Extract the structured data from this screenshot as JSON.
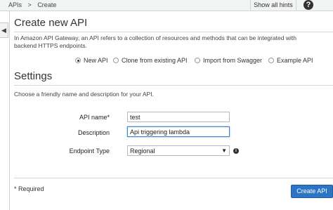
{
  "topbar": {
    "breadcrumb": [
      "APIs",
      ">",
      "Create"
    ],
    "hints_label": "Show all hints",
    "help_glyph": "?"
  },
  "sidebar_toggle_glyph": "◀",
  "create_section": {
    "title": "Create new API",
    "intro": "In Amazon API Gateway, an API refers to a collection of resources and methods that can be integrated with backend HTTPS endpoints.",
    "options": [
      {
        "label": "New API",
        "selected": true
      },
      {
        "label": "Clone from existing API",
        "selected": false
      },
      {
        "label": "Import from Swagger",
        "selected": false
      },
      {
        "label": "Example API",
        "selected": false
      }
    ]
  },
  "settings": {
    "title": "Settings",
    "description": "Choose a friendly name and description for your API.",
    "fields": {
      "api_name_label": "API name*",
      "api_name_value": "test",
      "description_label": "Description",
      "description_value": "Api triggering lambda",
      "endpoint_label": "Endpoint Type",
      "endpoint_value": "Regional",
      "info_glyph": "i"
    }
  },
  "footer": {
    "required_note": "* Required",
    "create_button": "Create API"
  },
  "colors": {
    "primary_button": "#2b75c4",
    "topbar": "#f2f3f3"
  }
}
